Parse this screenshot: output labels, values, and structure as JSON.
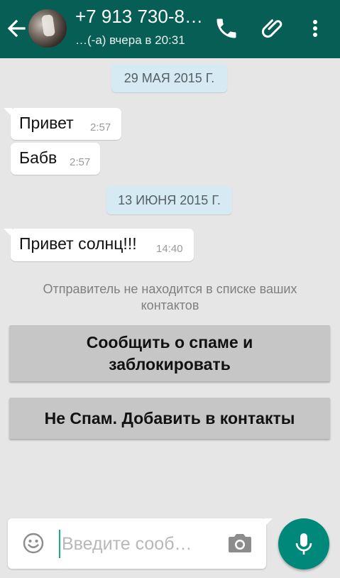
{
  "header": {
    "contact_name": "+7 913 730-8…",
    "last_seen": "…(-а) вчера в 20:31",
    "icons": {
      "back": "arrow-left-icon",
      "call": "phone-icon",
      "attach": "paperclip-icon",
      "menu": "more-vert-icon"
    }
  },
  "conversation": {
    "dates": [
      "29 МАЯ 2015 Г.",
      "13 ИЮНЯ 2015 Г."
    ],
    "messages": [
      {
        "text": "Привет",
        "time": "2:57"
      },
      {
        "text": "Бабв",
        "time": "2:57"
      },
      {
        "text": "Привет солнц!!!",
        "time": "14:40"
      }
    ]
  },
  "unknown_sender": {
    "notice": "Отправитель не находится в списке ваших контактов",
    "report_button": "Сообщить о спаме и заблокировать",
    "add_button": "Не Спам. Добавить в контакты"
  },
  "composer": {
    "placeholder": "Введите сооб…",
    "icons": {
      "emoji": "emoji-icon",
      "camera": "camera-icon",
      "mic": "microphone-icon"
    }
  },
  "colors": {
    "header": "#075e54",
    "background": "#e6e6e6",
    "date_chip": "#d5eaf3",
    "action_button": "#c6c6c6",
    "mic_button": "#00897b"
  }
}
